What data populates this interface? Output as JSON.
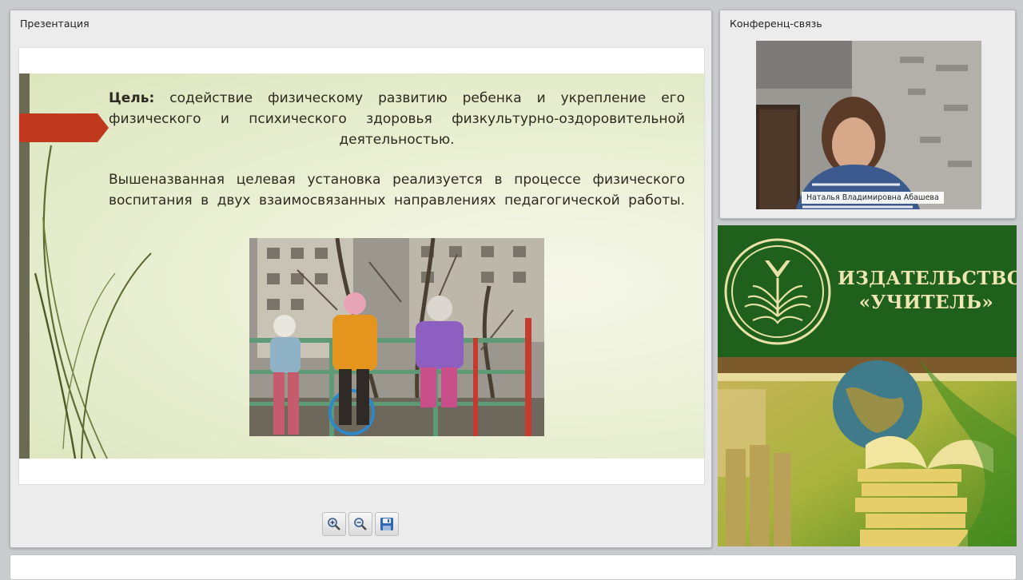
{
  "presentation": {
    "title": "Презентация",
    "slide": {
      "goal_label": "Цель:",
      "goal_text": "содействие физическому развитию ребенка и укрепление его физического и психического здоровья физкультурно-оздоровительной деятельностью.",
      "realized_text": "Вышеназванная целевая установка   реализуется в процессе физического воспитания в двух взаимосвязанных направлениях педагогической работы."
    },
    "toolbar": {
      "zoom_in_icon": "zoom-in-icon",
      "zoom_out_icon": "zoom-out-icon",
      "save_icon": "save-icon"
    }
  },
  "conference": {
    "title": "Конференц-связь",
    "speaker_name": "Наталья Владимировна Абашева"
  },
  "banner": {
    "name_line1": "ИЗДАТЕЛЬСТВО",
    "name_line2": "«УЧИТЕЛЬ»"
  },
  "colors": {
    "banner_green": "#1f601d",
    "slide_accent": "#c0391f",
    "brand_text": "#f0e6b4"
  }
}
